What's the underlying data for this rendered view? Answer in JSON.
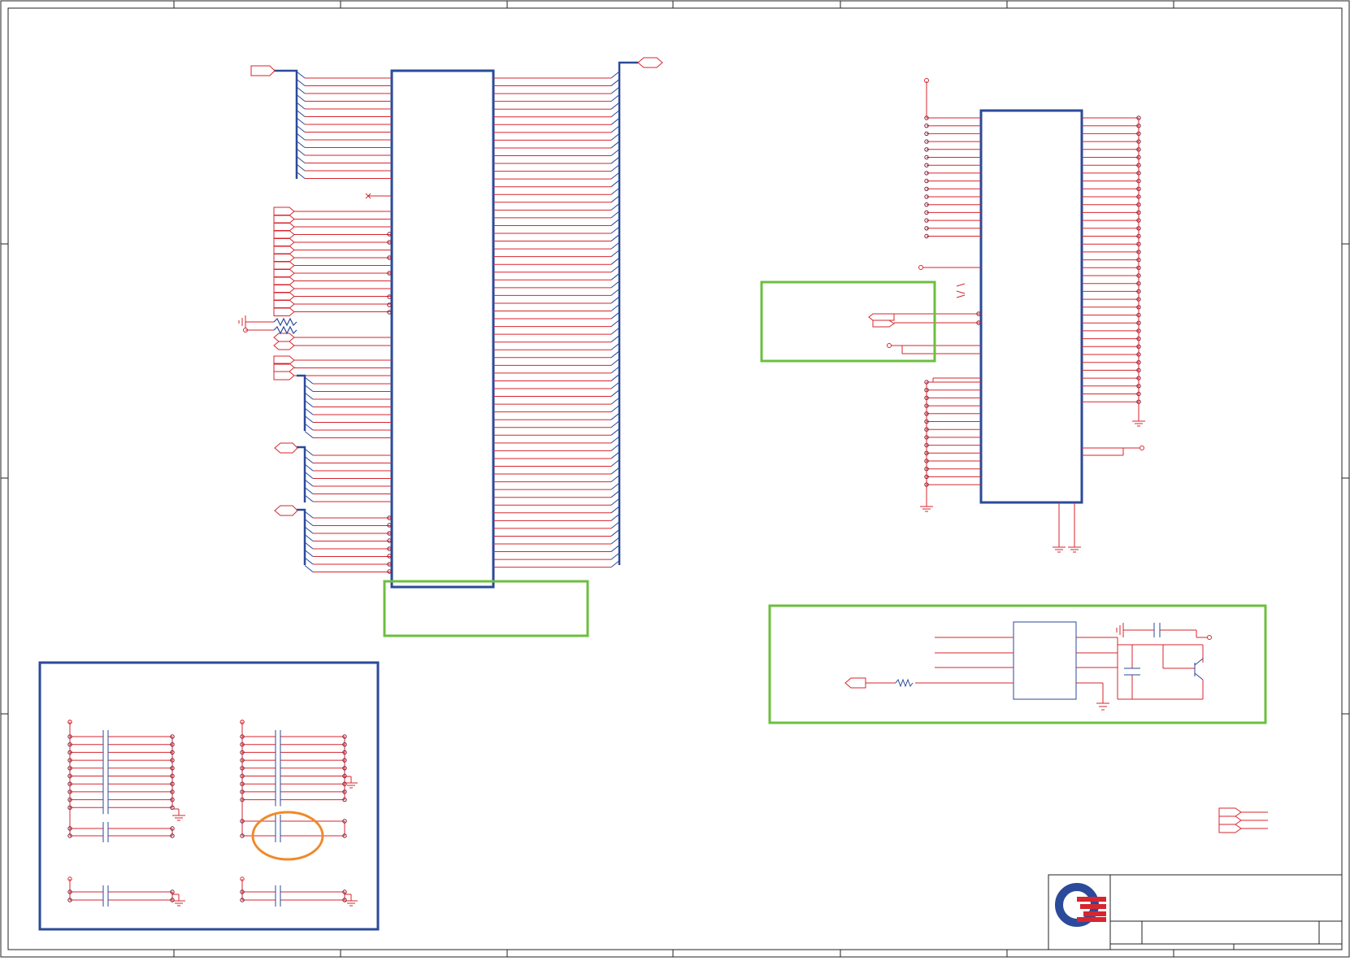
{
  "colors": {
    "wire": "#d7262e",
    "bus": "#2b4a9a",
    "net": "#7a1e3a",
    "highlight": "#6cbf3f",
    "callout": "#ef8a2a",
    "border": "#222222",
    "logo_blue": "#2b4a9a",
    "logo_red": "#d7262e"
  },
  "title_block": {
    "logo": "company-logo",
    "fields": [
      "",
      "",
      "",
      "",
      ""
    ]
  },
  "icons": {
    "ground": "ground-symbol",
    "capacitor": "capacitor-symbol",
    "resistor": "resistor-symbol",
    "transistor": "npn-transistor-symbol",
    "offpage": "offpage-connector-symbol"
  }
}
